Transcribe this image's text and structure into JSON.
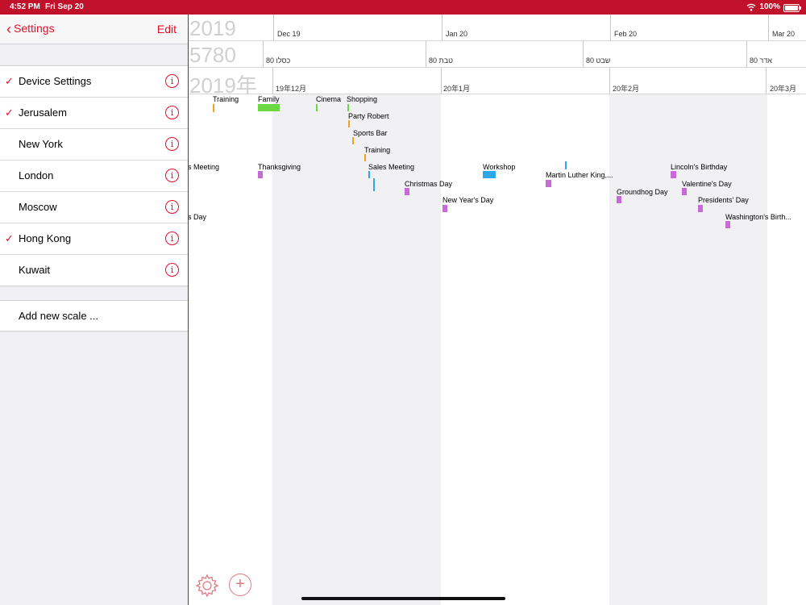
{
  "status": {
    "time": "4:52 PM",
    "date": "Fri Sep 20",
    "battery": "100%"
  },
  "sidebar": {
    "back_label": "Settings",
    "edit_label": "Edit",
    "items": [
      {
        "label": "Device Settings",
        "checked": true
      },
      {
        "label": "Jerusalem",
        "checked": true
      },
      {
        "label": "New York",
        "checked": false
      },
      {
        "label": "London",
        "checked": false
      },
      {
        "label": "Moscow",
        "checked": false
      },
      {
        "label": "Hong Kong",
        "checked": true
      },
      {
        "label": "Kuwait",
        "checked": false
      }
    ],
    "add_label": "Add new scale ...",
    "check_glyph": "✓",
    "info_glyph": "i"
  },
  "scales": [
    {
      "big": "2019",
      "ticks": [
        "Dec 19",
        "Jan 20",
        "Feb 20",
        "Mar 20"
      ]
    },
    {
      "big": "5780",
      "ticks": [
        "80 כסלו",
        "80 טבת",
        "80 שבט",
        "80 אדר"
      ]
    },
    {
      "big": "2019年",
      "ticks": [
        "19年12月",
        "20年1月",
        "20年2月",
        "20年3月"
      ]
    }
  ],
  "events": [
    {
      "label": "Training",
      "color": "#f5a020"
    },
    {
      "label": "Family",
      "color": "#6ad840"
    },
    {
      "label": "Cinema",
      "color": "#6ad840"
    },
    {
      "label": "Shopping",
      "color": "#6ad840"
    },
    {
      "label": "Party Robert",
      "color": "#f5a020"
    },
    {
      "label": "Sports Bar",
      "color": "#f5a020"
    },
    {
      "label": "Training",
      "color": "#f5a020"
    },
    {
      "label": "es Meeting",
      "color": "#2aa8e8"
    },
    {
      "label": "Thanksgiving",
      "color": "#c86ad8"
    },
    {
      "label": "Sales Meeting",
      "color": "#2aa8e8"
    },
    {
      "label": "Workshop",
      "color": "#2aa8e8"
    },
    {
      "label": "Martin Luther King,...",
      "color": "#c86ad8"
    },
    {
      "label": "Lincoln's Birthday",
      "color": "#c86ad8"
    },
    {
      "label": "Christmas Day",
      "color": "#c86ad8"
    },
    {
      "label": "Valentine's Day",
      "color": "#c86ad8"
    },
    {
      "label": "Groundhog Day",
      "color": "#c86ad8"
    },
    {
      "label": "New Year's Day",
      "color": "#c86ad8"
    },
    {
      "label": "Presidents' Day",
      "color": "#c86ad8"
    },
    {
      "label": "ns Day",
      "color": "#c86ad8"
    },
    {
      "label": "Washington's Birth...",
      "color": "#c86ad8"
    },
    {
      "label": "",
      "color": "#2aa8e8"
    },
    {
      "label": "",
      "color": "#2aa8e8"
    }
  ],
  "toolbar": {
    "add_glyph": "+"
  }
}
